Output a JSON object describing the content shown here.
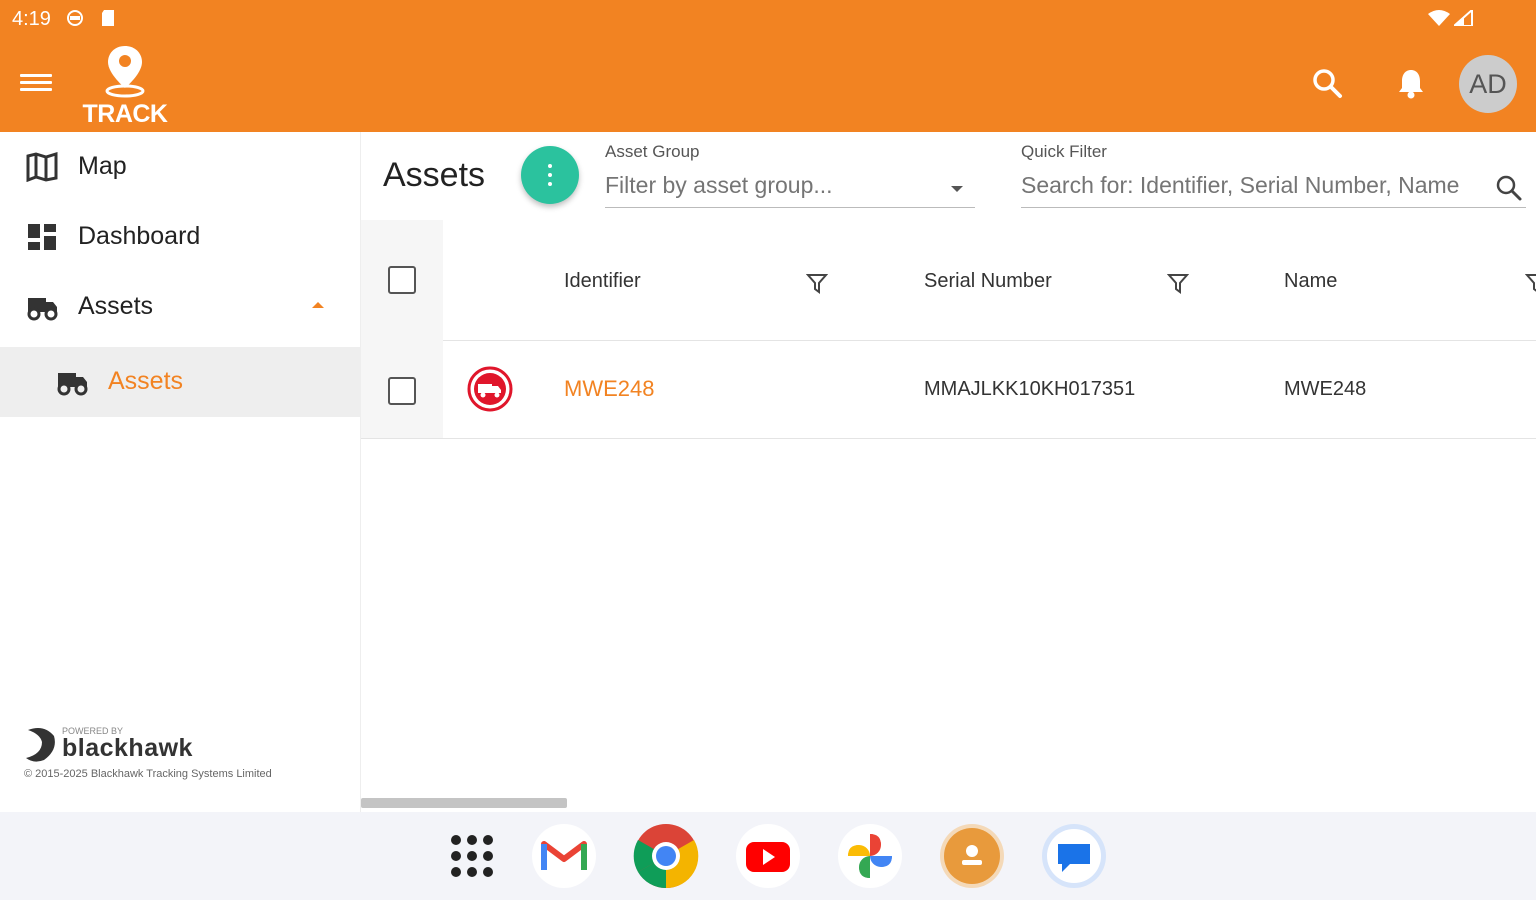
{
  "status_bar": {
    "time": "4:19"
  },
  "app": {
    "logo_text": "TRACK",
    "user_initials": "AD"
  },
  "colors": {
    "brand": "#F28322",
    "fab": "#2BC29E",
    "asset_icon": "#E0162B"
  },
  "sidebar": {
    "items": [
      {
        "label": "Map",
        "icon": "map-icon"
      },
      {
        "label": "Dashboard",
        "icon": "dashboard-icon"
      },
      {
        "label": "Assets",
        "icon": "truck-icon",
        "expanded": true
      },
      {
        "label": "Assets",
        "icon": "truck-icon",
        "active": true
      }
    ],
    "powered_by": "POWERED BY",
    "brand": "blackhawk",
    "copyright": "© 2015-2025 Blackhawk Tracking Systems Limited"
  },
  "main": {
    "title": "Assets",
    "asset_group": {
      "label": "Asset Group",
      "placeholder": "Filter by asset group..."
    },
    "quick_filter": {
      "label": "Quick Filter",
      "placeholder": "Search for: Identifier, Serial Number, Name"
    },
    "columns": [
      "Identifier",
      "Serial Number",
      "Name"
    ],
    "rows": [
      {
        "identifier": "MWE248",
        "serial_number": "MMAJLKK10KH017351",
        "name": "MWE248"
      }
    ]
  },
  "taskbar": {
    "apps": [
      "app-drawer-icon",
      "gmail-icon",
      "chrome-icon",
      "youtube-icon",
      "photos-icon",
      "track-app-icon",
      "messages-icon"
    ]
  }
}
